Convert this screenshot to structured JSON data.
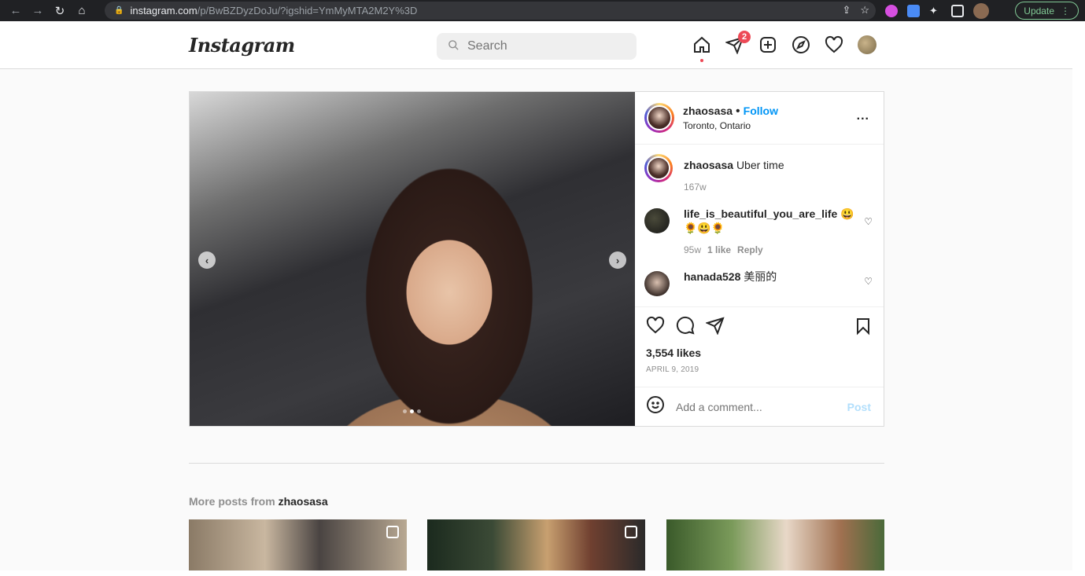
{
  "browser": {
    "url_host": "instagram.com",
    "url_path": "/p/BwBZDyzDoJu/?igshid=YmMyMTA2M2Y%3D",
    "update_label": "Update"
  },
  "header": {
    "logo": "Instagram",
    "search_placeholder": "Search",
    "dm_badge": "2"
  },
  "post": {
    "username": "zhaosasa",
    "follow_label": "Follow",
    "location": "Toronto, Ontario",
    "more_label": "...",
    "caption_user": "zhaosasa",
    "caption_text": "Uber time",
    "caption_age": "167w",
    "comments": [
      {
        "user": "life_is_beautiful_you_are_life",
        "text": "😃 🌻😃🌻",
        "age": "95w",
        "likes": "1 like",
        "reply": "Reply"
      },
      {
        "user": "hanada528",
        "text": "美丽的"
      }
    ],
    "likes": "3,554 likes",
    "date": "APRIL 9, 2019",
    "comment_placeholder": "Add a comment...",
    "post_label": "Post"
  },
  "more_posts": {
    "prefix": "More posts from",
    "user": "zhaosasa"
  }
}
